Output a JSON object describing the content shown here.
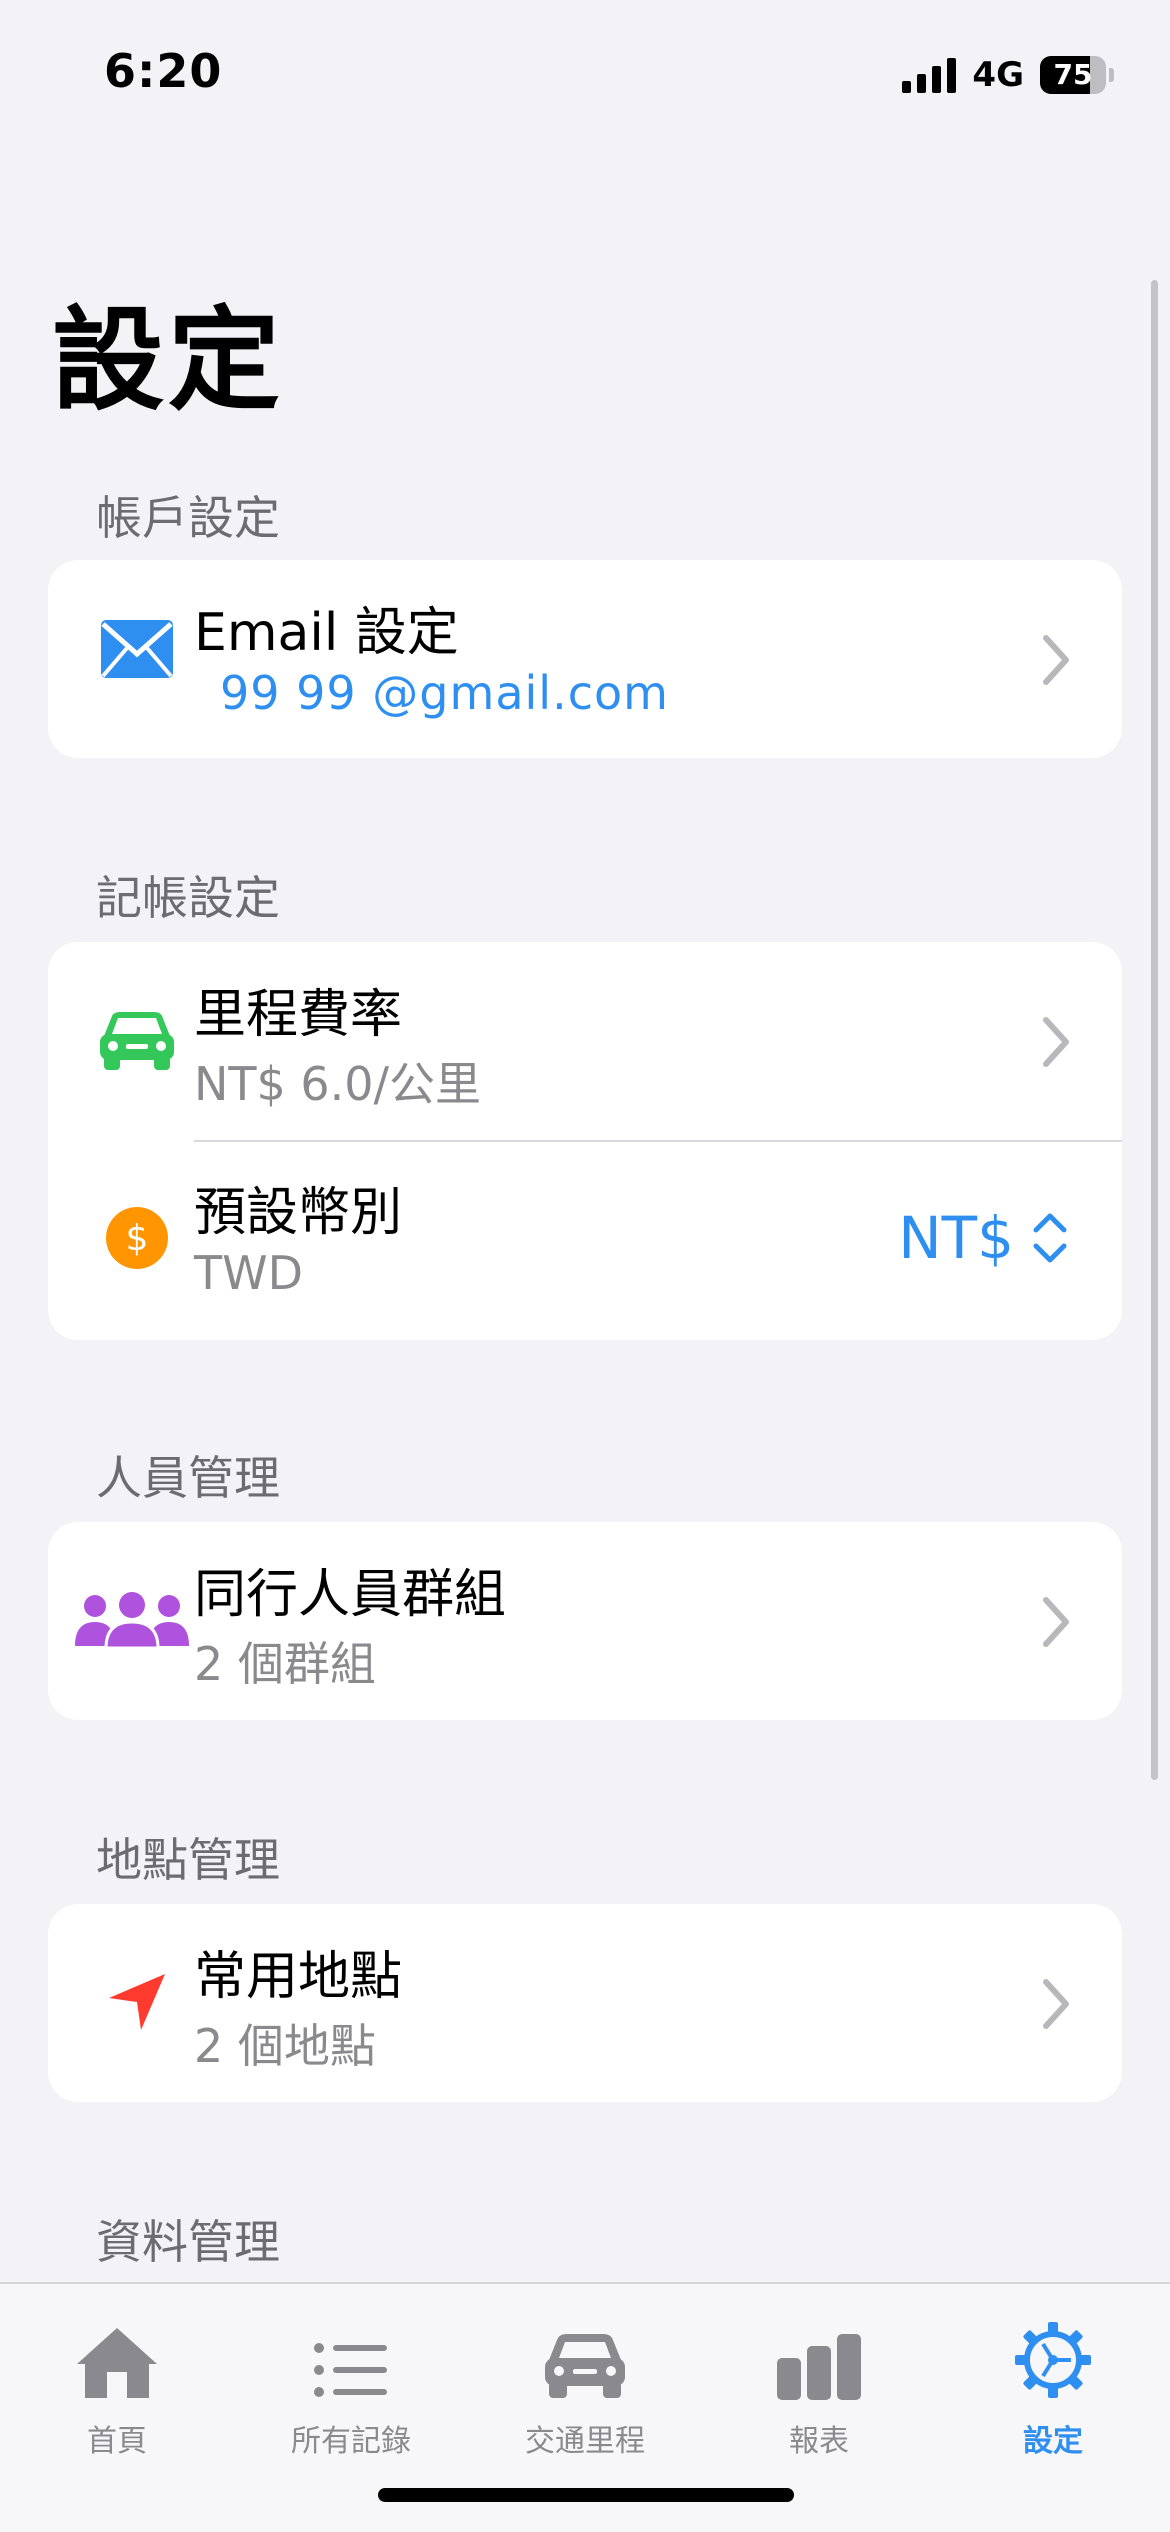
{
  "status_bar": {
    "time": "6:20",
    "network": "4G",
    "battery": "75",
    "battery_level": 0.75
  },
  "page": {
    "title": "設定"
  },
  "sections": {
    "account": {
      "header": "帳戶設定",
      "email": {
        "icon": "envelope-icon",
        "title": "Email 設定",
        "value": "99 99  @gmail.com"
      }
    },
    "bookkeeping": {
      "header": "記帳設定",
      "mileage": {
        "icon": "car-icon",
        "title": "里程費率",
        "value": "NT$ 6.0/公里"
      },
      "currency": {
        "icon": "dollar-circle-icon",
        "title": "預設幣別",
        "value": "TWD",
        "selected": "NT$"
      }
    },
    "people": {
      "header": "人員管理",
      "groups": {
        "icon": "people-icon",
        "title": "同行人員群組",
        "value": "2 個群組"
      }
    },
    "places": {
      "header": "地點管理",
      "frequent": {
        "icon": "location-arrow-icon",
        "title": "常用地點",
        "value": "2 個地點"
      }
    },
    "data": {
      "header": "資料管理"
    }
  },
  "tabs": [
    {
      "label": "首頁",
      "icon": "house-icon"
    },
    {
      "label": "所有記錄",
      "icon": "list-icon"
    },
    {
      "label": "交通里程",
      "icon": "car-icon"
    },
    {
      "label": "報表",
      "icon": "bar-chart-icon"
    },
    {
      "label": "設定",
      "icon": "gear-icon",
      "active": true
    }
  ],
  "colors": {
    "accent": "#2f8ff0",
    "car_green": "#34c759",
    "dollar_orange": "#ff9500",
    "people_purple": "#af52de",
    "location_red": "#ff3b30"
  }
}
